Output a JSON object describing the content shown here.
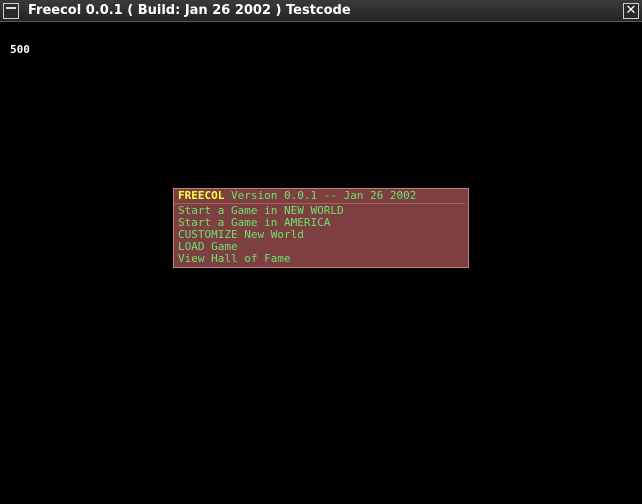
{
  "window": {
    "title": "Freecol 0.0.1 ( Build: Jan 26 2002 ) Testcode",
    "close_glyph": "✕"
  },
  "counter": "500",
  "menu": {
    "app_name": "FREECOL",
    "version_text": " Version 0.0.1 -- Jan 26 2002",
    "items": [
      {
        "label": "Start a Game in NEW WORLD"
      },
      {
        "label": "Start a Game in AMERICA"
      },
      {
        "label": "CUSTOMIZE New World"
      },
      {
        "label": "LOAD Game"
      },
      {
        "label": "View Hall of Fame"
      }
    ]
  },
  "colors": {
    "background": "#000000",
    "menu_bg": "#7d3f3f",
    "menu_border": "#c08080",
    "menu_text": "#70e070",
    "header_highlight": "#ffff40"
  },
  "icons": {
    "window_menu": "window-menu-icon",
    "close": "close-icon"
  }
}
